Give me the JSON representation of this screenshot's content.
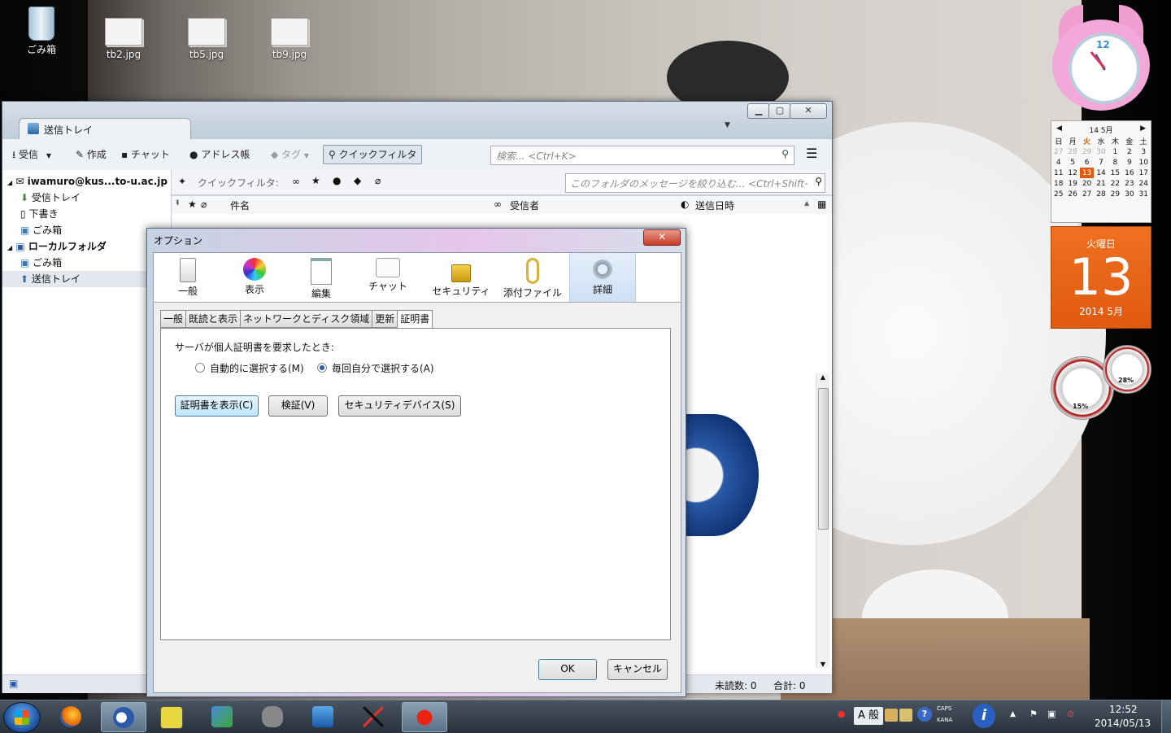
{
  "desktop": {
    "icons": [
      {
        "label": "ごみ箱"
      },
      {
        "label": "tb2.jpg"
      },
      {
        "label": "tb5.jpg"
      },
      {
        "label": "tb9.jpg"
      }
    ]
  },
  "gadgets": {
    "clock_number": "12",
    "calendar": {
      "month_header": "14 5月",
      "weekdays": [
        "日",
        "月",
        "火",
        "水",
        "木",
        "金",
        "土"
      ],
      "weeks": [
        [
          "27",
          "28",
          "29",
          "30",
          "1",
          "2",
          "3"
        ],
        [
          "4",
          "5",
          "6",
          "7",
          "8",
          "9",
          "10"
        ],
        [
          "11",
          "12",
          "13",
          "14",
          "15",
          "16",
          "17"
        ],
        [
          "18",
          "19",
          "20",
          "21",
          "22",
          "23",
          "24"
        ],
        [
          "25",
          "26",
          "27",
          "28",
          "29",
          "30",
          "31"
        ]
      ],
      "day_of_week": "火曜日",
      "day": "13",
      "year_month": "2014 5月"
    },
    "meter": {
      "cpu": "15%",
      "memory": "28%"
    }
  },
  "thunderbird": {
    "tab_label": "送信トレイ",
    "window_controls": {
      "minimize": "▁",
      "maximize": "▢",
      "close": "✕"
    },
    "toolbar": {
      "get_mail": "受信",
      "write": "作成",
      "chat": "チャット",
      "address_book": "アドレス帳",
      "tag": "タグ",
      "quick_filter": "クイックフィルタ"
    },
    "search": {
      "placeholder": "検索... <Ctrl+K>"
    },
    "folders": {
      "account": "iwamuro@kus...to-u.ac.jp",
      "account_folders": [
        "受信トレイ",
        "下書き",
        "ごみ箱"
      ],
      "local": "ローカルフォルダ",
      "local_folders": [
        "ごみ箱",
        "送信トレイ"
      ]
    },
    "quickfilter": {
      "label": "クイックフィルタ:",
      "search_placeholder": "このフォルダのメッセージを絞り込む... <Ctrl+Shift+"
    },
    "columns": {
      "subject": "件名",
      "recipient": "受信者",
      "date": "送信日時"
    },
    "status": {
      "unread": "未読数: 0",
      "total": "合計: 0"
    }
  },
  "dialog": {
    "title": "オプション",
    "close": "✕",
    "panes": [
      {
        "label": "一般"
      },
      {
        "label": "表示"
      },
      {
        "label": "編集"
      },
      {
        "label": "チャット"
      },
      {
        "label": "セキュリティ"
      },
      {
        "label": "添付ファイル"
      },
      {
        "label": "詳細"
      }
    ],
    "subtabs": [
      "一般",
      "既読と表示",
      "ネットワークとディスク領域",
      "更新",
      "証明書"
    ],
    "cert_prompt": "サーバが個人証明書を要求したとき:",
    "radio_auto": "自動的に選択する(M)",
    "radio_ask": "毎回自分で選択する(A)",
    "btn_view": "証明書を表示(C)",
    "btn_validate": "検証(V)",
    "btn_devices": "セキュリティデバイス(S)",
    "ok": "OK",
    "cancel": "キャンセル"
  },
  "taskbar": {
    "ime": "A 般",
    "caps": "CAPS",
    "kana": "KANA",
    "time": "12:52",
    "date": "2014/05/13"
  }
}
